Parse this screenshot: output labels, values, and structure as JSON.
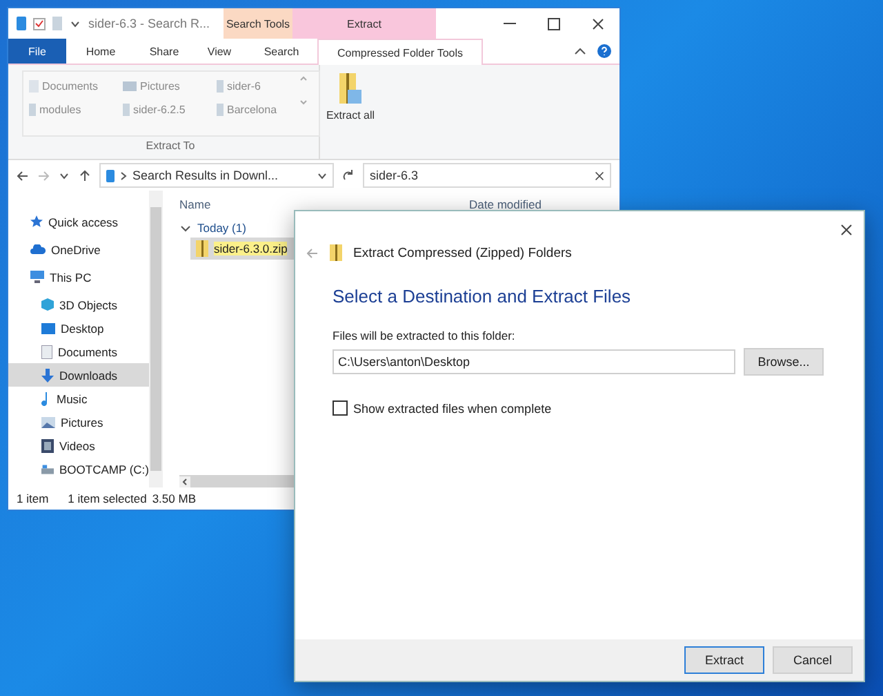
{
  "explorer": {
    "title": "sider-6.3 - Search R...",
    "context_tabs": [
      {
        "label": "Search Tools",
        "color": "#fbd9c3"
      },
      {
        "label": "Extract",
        "color": "#f9c6dc"
      }
    ],
    "tabs": [
      {
        "label": "File",
        "selected": false
      },
      {
        "label": "Home",
        "selected": false
      },
      {
        "label": "Share",
        "selected": false
      },
      {
        "label": "View",
        "selected": false
      },
      {
        "label": "Search",
        "selected": false
      },
      {
        "label": "Compressed Folder Tools",
        "selected": true
      }
    ],
    "ribbon": {
      "locations": [
        "Documents",
        "Pictures",
        "sider-6",
        "modules",
        "sider-6.2.5",
        "Barcelona"
      ],
      "extract_all": "Extract all",
      "group_label": "Extract To"
    },
    "address": {
      "path": "Search Results in Downl...",
      "search": "sider-6.3"
    },
    "columns": [
      "Name",
      "Date modified"
    ],
    "group": "Today (1)",
    "files": [
      {
        "name": "sider-6.3.0.zip",
        "selected": true
      }
    ],
    "nav": [
      {
        "label": "Quick access",
        "selected": false
      },
      {
        "label": "OneDrive",
        "selected": false
      },
      {
        "label": "This PC",
        "selected": false,
        "children": [
          {
            "label": "3D Objects",
            "selected": false
          },
          {
            "label": "Desktop",
            "selected": false
          },
          {
            "label": "Documents",
            "selected": false
          },
          {
            "label": "Downloads",
            "selected": true
          },
          {
            "label": "Music",
            "selected": false
          },
          {
            "label": "Pictures",
            "selected": false
          },
          {
            "label": "Videos",
            "selected": false
          },
          {
            "label": "BOOTCAMP (C:)",
            "selected": false
          }
        ]
      }
    ],
    "status": [
      "1 item",
      "1 item selected",
      "3.50 MB"
    ]
  },
  "dialog": {
    "header": "Extract Compressed (Zipped) Folders",
    "heading": "Select a Destination and Extract Files",
    "field_label": "Files will be extracted to this folder:",
    "path": "C:\\Users\\anton\\Desktop",
    "browse": "Browse...",
    "checkbox": {
      "label": "Show extracted files when complete",
      "checked": false
    },
    "buttons": [
      {
        "label": "Extract",
        "default": true
      },
      {
        "label": "Cancel",
        "default": false
      }
    ]
  }
}
